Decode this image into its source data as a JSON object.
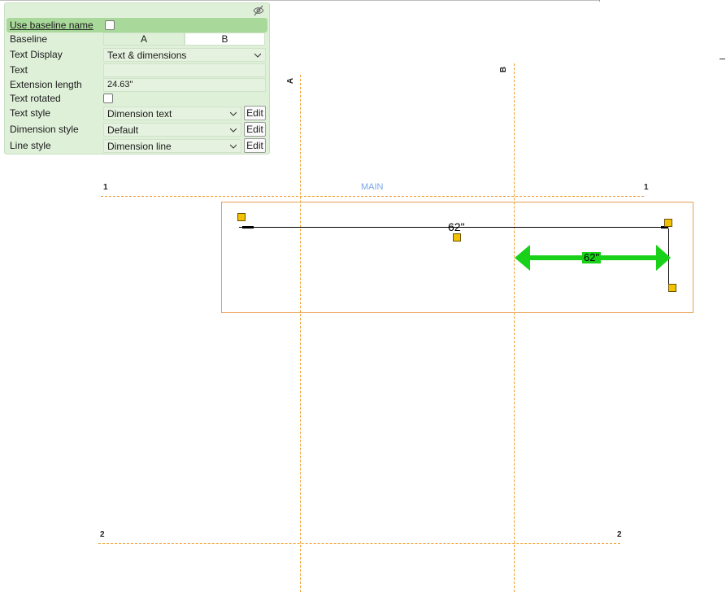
{
  "panel": {
    "header_label": "Use baseline name",
    "baseline": {
      "label": "Baseline",
      "option_a": "A",
      "option_b": "B",
      "selected": "B"
    },
    "text_display": {
      "label": "Text Display",
      "value": "Text & dimensions"
    },
    "text": {
      "label": "Text",
      "value": ""
    },
    "extension_length": {
      "label": "Extension length",
      "value": "24.63\""
    },
    "text_rotated": {
      "label": "Text rotated"
    },
    "text_style": {
      "label": "Text style",
      "value": "Dimension text",
      "edit": "Edit"
    },
    "dimension_style": {
      "label": "Dimension style",
      "value": "Default",
      "edit": "Edit"
    },
    "line_style": {
      "label": "Line style",
      "value": "Dimension line",
      "edit": "Edit"
    },
    "hide_icon": "eye-slash-icon"
  },
  "canvas": {
    "grid_h1_left": "1",
    "grid_h1_right": "1",
    "grid_h2_left": "2",
    "grid_h2_right": "2",
    "grid_va": "A",
    "grid_vb": "B",
    "view_name": "MAIN",
    "dim_label": "62\"",
    "selected_dim_label": "62\"",
    "grid_color": "#f0a030",
    "selection_color": "#19d119",
    "handle_color": "#f2c200"
  }
}
